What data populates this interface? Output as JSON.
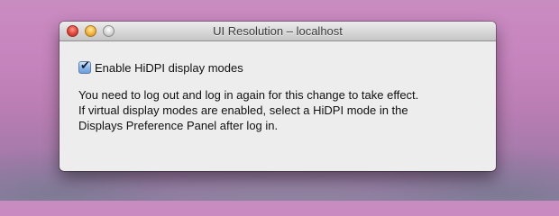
{
  "window": {
    "title": "UI Resolution – localhost"
  },
  "controls": {
    "close": "close",
    "minimize": "minimize",
    "zoom": "zoom"
  },
  "option": {
    "label": "Enable HiDPI display modes",
    "checked": true,
    "check_glyph": "✔"
  },
  "message": {
    "lines": [
      "You need to log out and log in again for this change to take effect.",
      "If virtual display modes are enabled, select a HiDPI mode in the",
      "Displays Preference Panel after log in."
    ]
  },
  "colors": {
    "close": "#e0443a",
    "minimize": "#f3b33c",
    "zoom": "#d6d6d6",
    "checkbox": "#6a9fe0"
  }
}
